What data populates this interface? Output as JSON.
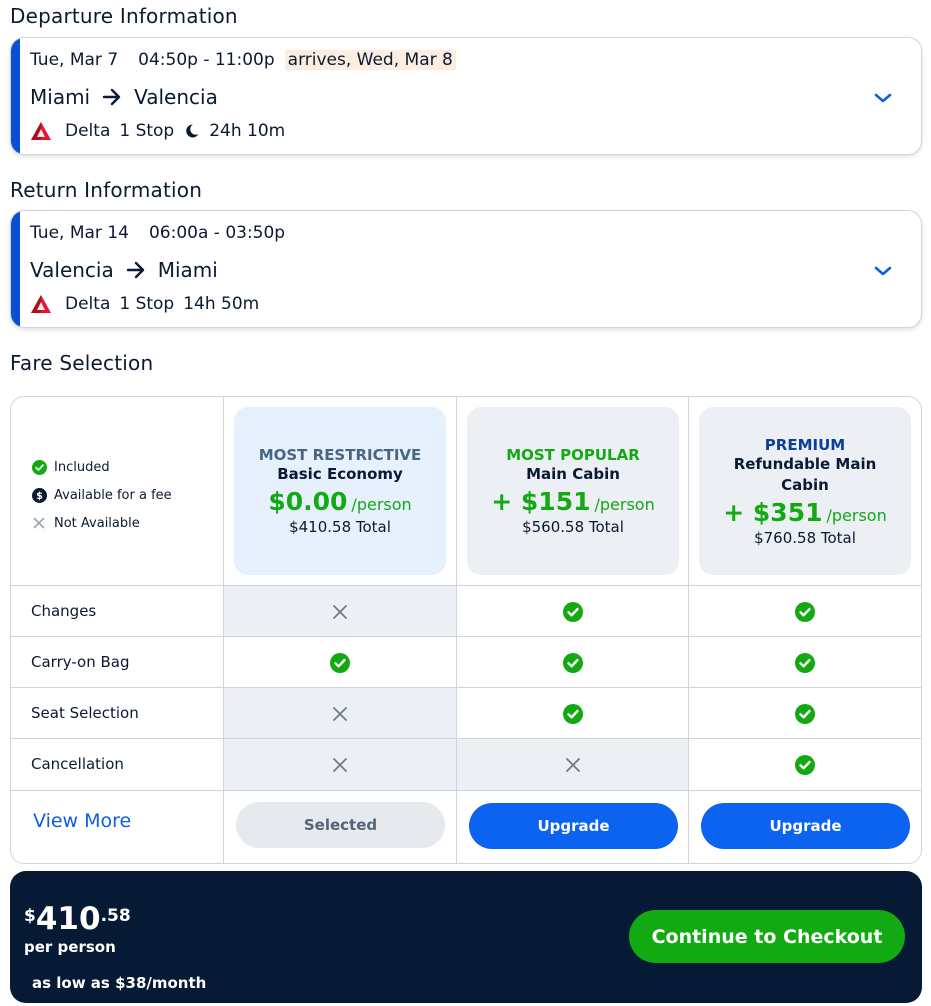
{
  "departure": {
    "section_title": "Departure Information",
    "date": "Tue, Mar 7",
    "time": "04:50p - 11:00p",
    "arrives": "arrives, Wed, Mar 8",
    "from": "Miami",
    "to": "Valencia",
    "airline": "Delta",
    "stops": "1 Stop",
    "duration": "24h 10m"
  },
  "return": {
    "section_title": "Return Information",
    "date": "Tue, Mar 14",
    "time": "06:00a - 03:50p",
    "from": "Valencia",
    "to": "Miami",
    "airline": "Delta",
    "stops": "1 Stop",
    "duration": "14h 50m"
  },
  "fare_selection": {
    "title": "Fare Selection",
    "legend": {
      "included": "Included",
      "fee": "Available for a fee",
      "not_available": "Not Available"
    },
    "fares": [
      {
        "tag": "MOST RESTRICTIVE",
        "name": "Basic Economy",
        "price": "$0.00",
        "per": "/person",
        "total": "$410.58 Total",
        "tag_color": "#4a6584",
        "bg": "#e6f1fd"
      },
      {
        "tag": "MOST POPULAR",
        "name": "Main Cabin",
        "price": "+ $151",
        "per": "/person",
        "total": "$560.58 Total",
        "tag_color": "#13a913",
        "bg": "#eceff3"
      },
      {
        "tag": "PREMIUM",
        "name": "Refundable Main Cabin",
        "price": "+ $351",
        "per": "/person",
        "total": "$760.58 Total",
        "tag_color": "#0b3f9a",
        "bg": "#eceff3"
      }
    ],
    "features": [
      {
        "label": "Changes",
        "values": [
          "not_available",
          "included",
          "included"
        ]
      },
      {
        "label": "Carry-on Bag",
        "values": [
          "included",
          "included",
          "included"
        ]
      },
      {
        "label": "Seat Selection",
        "values": [
          "not_available",
          "included",
          "included"
        ]
      },
      {
        "label": "Cancellation",
        "values": [
          "not_available",
          "not_available",
          "included"
        ]
      }
    ],
    "view_more": "View More",
    "buttons": [
      "Selected",
      "Upgrade",
      "Upgrade"
    ]
  },
  "checkout": {
    "currency": "$",
    "price_int": "410",
    "price_dec": ".58",
    "per_person": "per person",
    "low_as": "as low as $38/month",
    "button": "Continue to Checkout"
  },
  "colors": {
    "accent": "#0b4fd4",
    "included_green": "#13a913",
    "primary_blue": "#0b63f0",
    "dark_navy": "#061a36"
  }
}
